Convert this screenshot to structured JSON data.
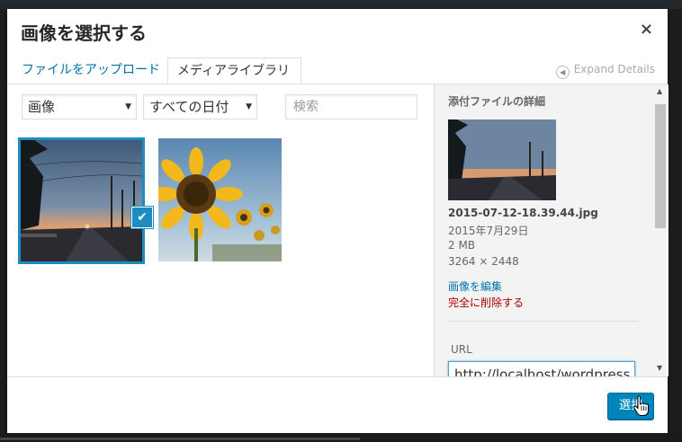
{
  "modal": {
    "title": "画像を選択する",
    "close_icon": "×",
    "tabs": [
      {
        "label": "ファイルをアップロード"
      },
      {
        "label": "メディアライブラリ"
      }
    ],
    "expand_details": "Expand Details"
  },
  "filters": {
    "type_value": "画像",
    "date_value": "すべての日付",
    "search_placeholder": "検索"
  },
  "attachments": [
    {
      "kind": "street-sunset-photo",
      "selected": true
    },
    {
      "kind": "sunflower-photo",
      "selected": false
    }
  ],
  "details": {
    "heading": "添付ファイルの詳細",
    "filename": "2015-07-12-18.39.44.jpg",
    "date": "2015年7月29日",
    "size": "2 MB",
    "dimensions": "3264 × 2448",
    "edit_link": "画像を編集",
    "delete_link": "完全に削除する",
    "url_label": "URL",
    "url_value": "http://localhost/wordpress"
  },
  "footer": {
    "select_button": "選択"
  },
  "colors": {
    "accent": "#0085ba",
    "selection": "#1e8cbe",
    "link": "#0073aa",
    "delete": "#aa0000"
  }
}
